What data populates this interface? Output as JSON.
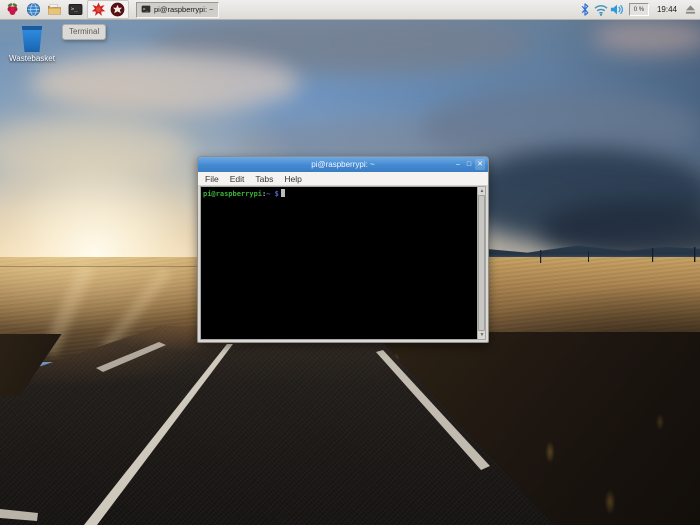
{
  "taskbar": {
    "launchers": [
      {
        "name": "menu-raspberry"
      },
      {
        "name": "web-browser"
      },
      {
        "name": "file-manager"
      },
      {
        "name": "terminal"
      },
      {
        "name": "mathematica"
      },
      {
        "name": "wolfram"
      }
    ],
    "task_button": {
      "label": "pi@raspberrypi: ~",
      "icon": "terminal-icon"
    },
    "tray": {
      "icons": [
        "bluetooth-icon",
        "wifi-icon",
        "volume-icon",
        "eject-icon"
      ],
      "cpu": "0 %",
      "clock": "19:44"
    }
  },
  "tooltip": {
    "text": "Terminal"
  },
  "desktop": {
    "wastebasket_label": "Wastebasket"
  },
  "window": {
    "title": "pi@raspberrypi: ~",
    "controls": {
      "minimize": "–",
      "maximize": "□",
      "close": "✕"
    },
    "menu": [
      "File",
      "Edit",
      "Tabs",
      "Help"
    ],
    "terminal": {
      "prompt_user": "pi@raspberrypi",
      "prompt_separator": ":",
      "prompt_path": "~",
      "prompt_symbol": " $"
    }
  },
  "colors": {
    "titlebar": "#4489d1",
    "titlebar-light": "#6caae5",
    "prompt-green": "#3ab43a",
    "prompt-blue": "#4d6cd8",
    "terminal-bg": "#000000",
    "taskbar-bg": "#e6e4e0"
  }
}
